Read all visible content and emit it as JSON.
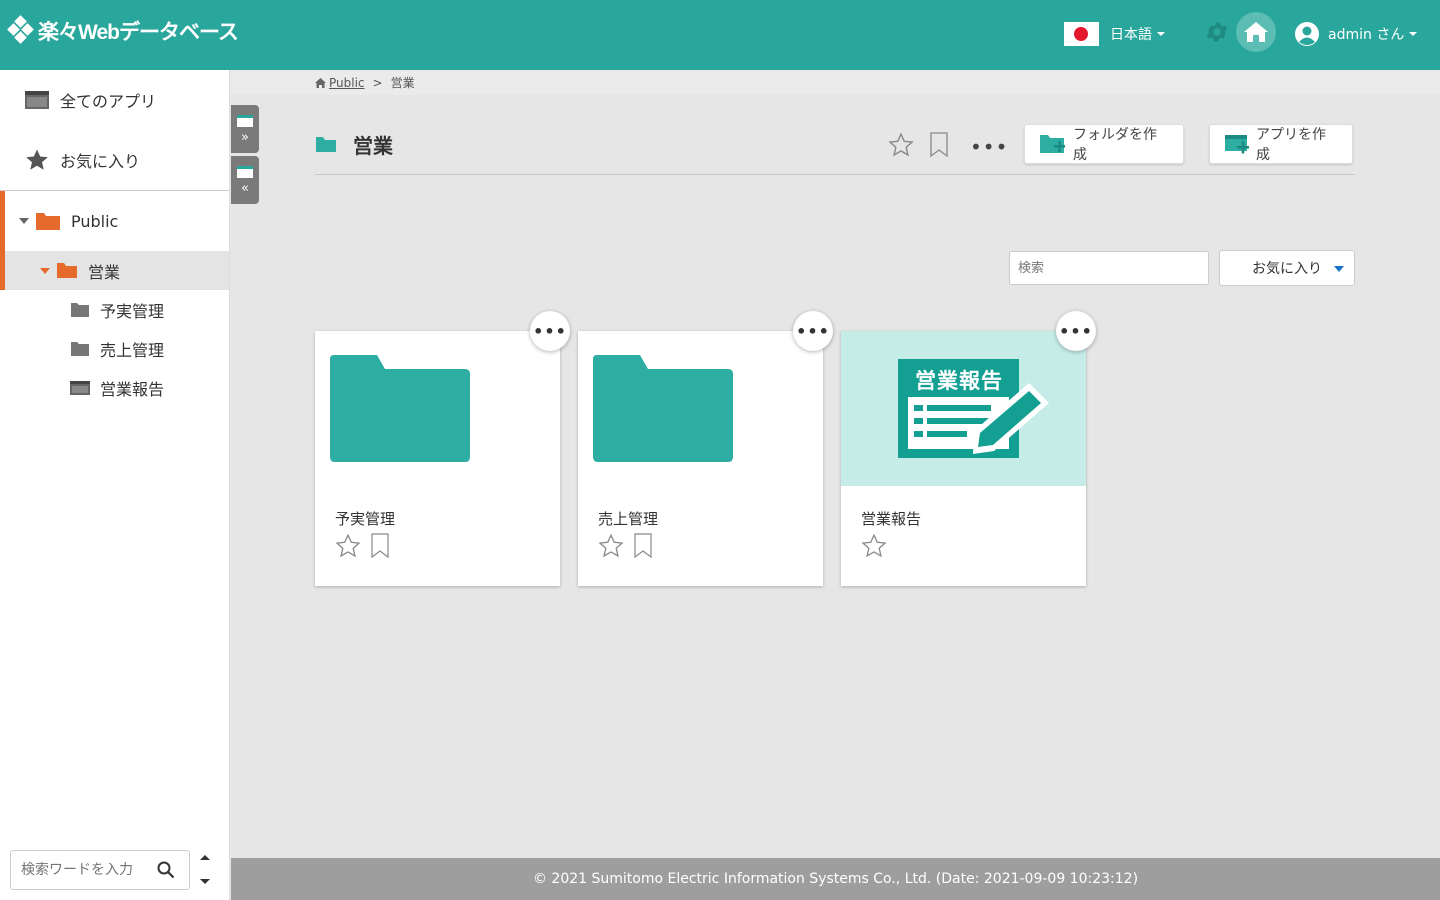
{
  "header": {
    "logo_text": "楽々Webデータベース",
    "language": "日本語",
    "user": "admin さん"
  },
  "sidebar": {
    "all_apps": "全てのアプリ",
    "favorites": "お気に入り",
    "tree": {
      "root": "Public",
      "current": "営業",
      "children": [
        "予実管理",
        "売上管理",
        "営業報告"
      ]
    },
    "search_placeholder": "検索ワードを入力"
  },
  "breadcrumb": {
    "root": "Public",
    "separator": ">",
    "current": "営業"
  },
  "page": {
    "title": "営業",
    "more": "•••",
    "create_folder": "フォルダを作成",
    "create_app": "アプリを作成"
  },
  "filter": {
    "search_placeholder": "検索",
    "select_value": "お気に入り"
  },
  "cards": [
    {
      "name": "予実管理",
      "type": "folder"
    },
    {
      "name": "売上管理",
      "type": "folder"
    },
    {
      "name": "営業報告",
      "type": "app",
      "thumb_text": "営業報告"
    }
  ],
  "card_more": "•••",
  "footer": {
    "text": "© 2021 Sumitomo Electric Information Systems Co., Ltd. (Date: 2021-09-09 10:23:12)"
  },
  "colors": {
    "header": "#2aa79c",
    "folder_teal": "#2eaea3",
    "accent_orange": "#e56a2b",
    "thumb_bg": "#c6ece8"
  }
}
